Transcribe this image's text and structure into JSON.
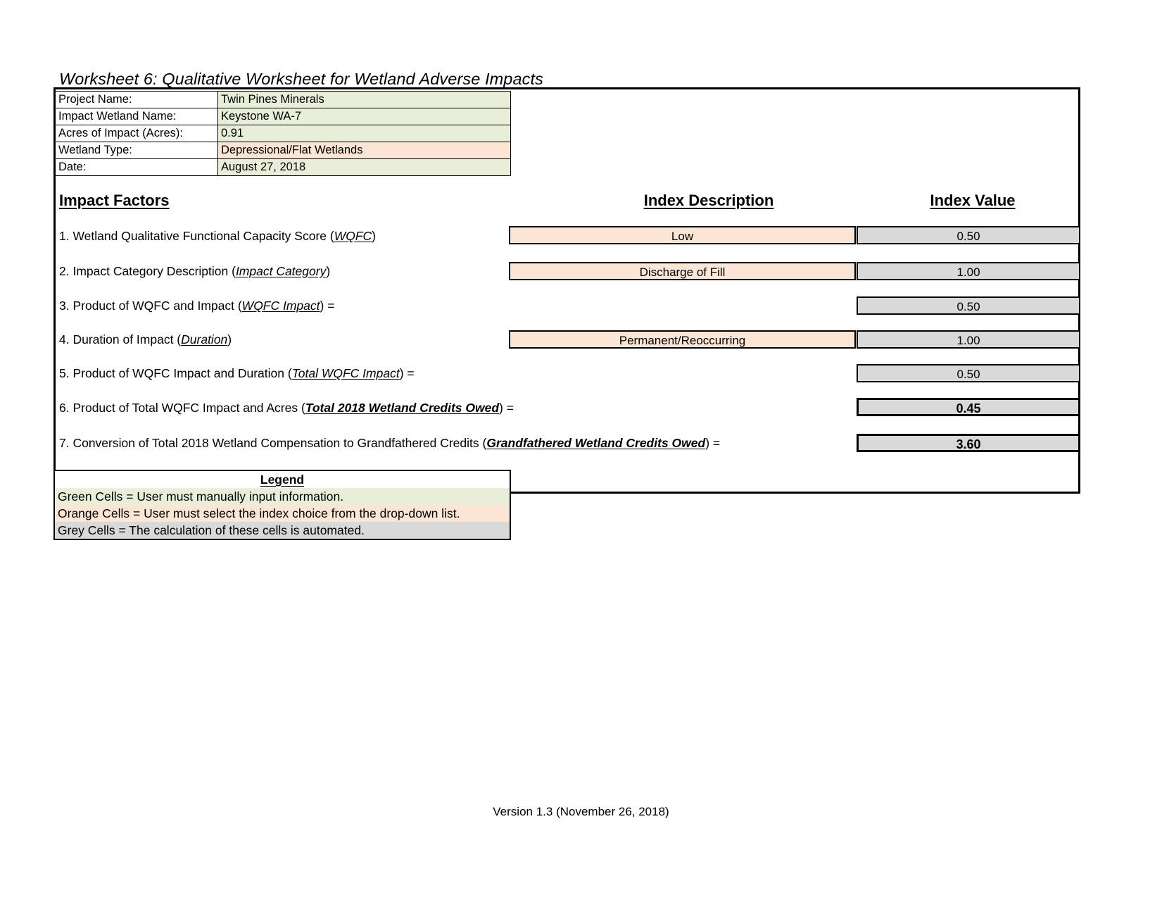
{
  "worksheet": {
    "title": "Worksheet 6:  Qualitative Worksheet for Wetland Adverse Impacts"
  },
  "info": {
    "rows": [
      {
        "label": "Project Name:",
        "value": "Twin Pines Minerals",
        "fill": "green"
      },
      {
        "label": "Impact Wetland Name:",
        "value": "Keystone WA-7",
        "fill": "green"
      },
      {
        "label": "Acres of Impact (Acres):",
        "value": "0.91",
        "fill": "green"
      },
      {
        "label": "Wetland Type:",
        "value": "Depressional/Flat Wetlands",
        "fill": "orange"
      },
      {
        "label": "Date:",
        "value": "August 27, 2018",
        "fill": "green"
      }
    ]
  },
  "columns": {
    "impact_factors": "Impact Factors",
    "index_description": "Index Description",
    "index_value": "Index Value"
  },
  "factors": [
    {
      "number": "1.",
      "text_before": "1. Wetland Qualitative Functional Capacity Score (",
      "term": "WQFC",
      "text_after": ")",
      "description": "Low",
      "value": "0.50"
    },
    {
      "number": "2.",
      "text_before": "2. Impact Category Description (",
      "term": "Impact Category",
      "text_after": ")",
      "description": "Discharge of Fill",
      "value": "1.00"
    },
    {
      "number": "3.",
      "text_before": "3. Product of WQFC and Impact (",
      "term": "WQFC Impact",
      "text_after": ") =",
      "description": "",
      "value": "0.50"
    },
    {
      "number": "4.",
      "text_before": "4. Duration of Impact (",
      "term": "Duration",
      "text_after": ")",
      "description": "Permanent/Reoccurring",
      "value": "1.00"
    },
    {
      "number": "5.",
      "text_before": "5. Product of WQFC Impact and Duration (",
      "term": "Total WQFC Impact",
      "text_after": ") =",
      "description": "",
      "value": "0.50"
    },
    {
      "number": "6.",
      "text_before": "6. Product of Total WQFC Impact and Acres (",
      "term": "Total 2018 Wetland Credits Owed",
      "text_after": ") =",
      "description": "",
      "value": "0.45"
    },
    {
      "number": "7.",
      "text_before": "7. Conversion of Total 2018 Wetland Compensation to Grandfathered Credits (",
      "term": "Grandfathered Wetland Credits Owed",
      "text_after": ") =",
      "description": "",
      "value": "3.60"
    }
  ],
  "legend": {
    "title": "Legend",
    "green": "Green Cells = User must manually input information.",
    "orange": "Orange Cells = User must select the index choice from the drop-down list.",
    "grey": "Grey Cells = The calculation of these cells is automated."
  },
  "footer": {
    "version": "Version 1.3 (November 26, 2018)"
  },
  "colors": {
    "green_fill": "#e9eed9",
    "orange_fill": "#fbe5d5",
    "grey_fill": "#d9d9d9",
    "border": "#000000"
  }
}
